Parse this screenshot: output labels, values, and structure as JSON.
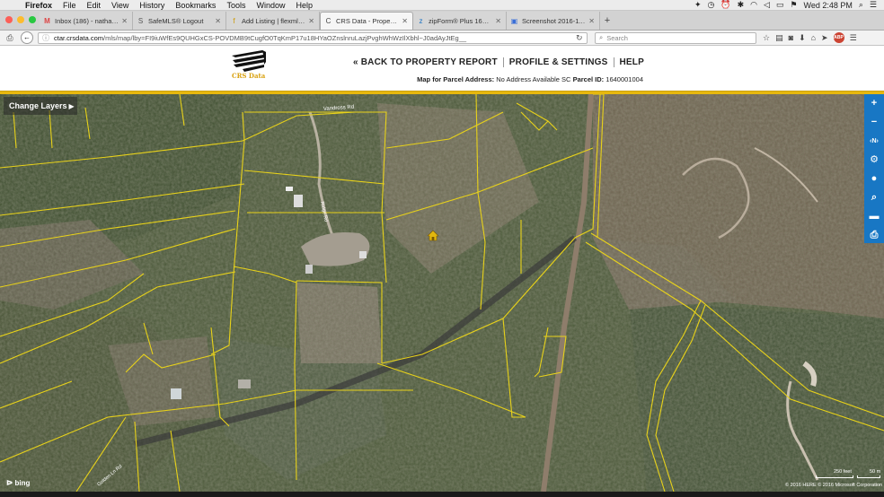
{
  "menubar": {
    "app": "Firefox",
    "items": [
      "File",
      "Edit",
      "View",
      "History",
      "Bookmarks",
      "Tools",
      "Window",
      "Help"
    ],
    "clock": "Wed 2:48 PM"
  },
  "tabs": [
    {
      "label": "Inbox (186) - nathanmhend...",
      "icon": "M"
    },
    {
      "label": "SafeMLS® Logout",
      "icon": "S"
    },
    {
      "label": "Add Listing | flexmls Web",
      "icon": "f"
    },
    {
      "label": "CRS Data - Property Map for",
      "icon": "C",
      "active": true
    },
    {
      "label": "zipForm® Plus 1610.28",
      "icon": "z"
    },
    {
      "label": "Screenshot 2016-11-01 12....",
      "icon": "▣"
    }
  ],
  "navbar": {
    "url_host": "ctar.crsdata.com",
    "url_path": "/mls/map/lby=FI9iuWfEs9QUHGxCS-POVDMB9tCugfO0TqKmP17u18HYaOZnslnruLazjPvghWhWzIlXbhl~J0adAyJtEg__",
    "search_placeholder": "Search"
  },
  "site": {
    "logo_text": "CRS Data",
    "nav": {
      "back": "« BACK TO PROPERTY REPORT",
      "profile": "PROFILE & SETTINGS",
      "help": "HELP"
    },
    "parcel": {
      "label1": "Map for Parcel Address:",
      "address": "No Address Available SC",
      "label2": "Parcel ID:",
      "id": "1640001004"
    }
  },
  "map": {
    "change_layers": "Change Layers",
    "road_labels": [
      "Vandross Rd",
      "Ridge Rd",
      "Golden Ln Rd"
    ],
    "tools": [
      "+",
      "−",
      "N",
      "gear",
      "pin",
      "search",
      "ruler",
      "print"
    ],
    "bing": "bing",
    "scale_feet": "250 feet",
    "scale_m": "50 m",
    "copyright": "© 2016 HERE   © 2016 Microsoft Corporation",
    "parcel_line_color": "#e8d21a",
    "marker_color": "#e2b70e"
  }
}
